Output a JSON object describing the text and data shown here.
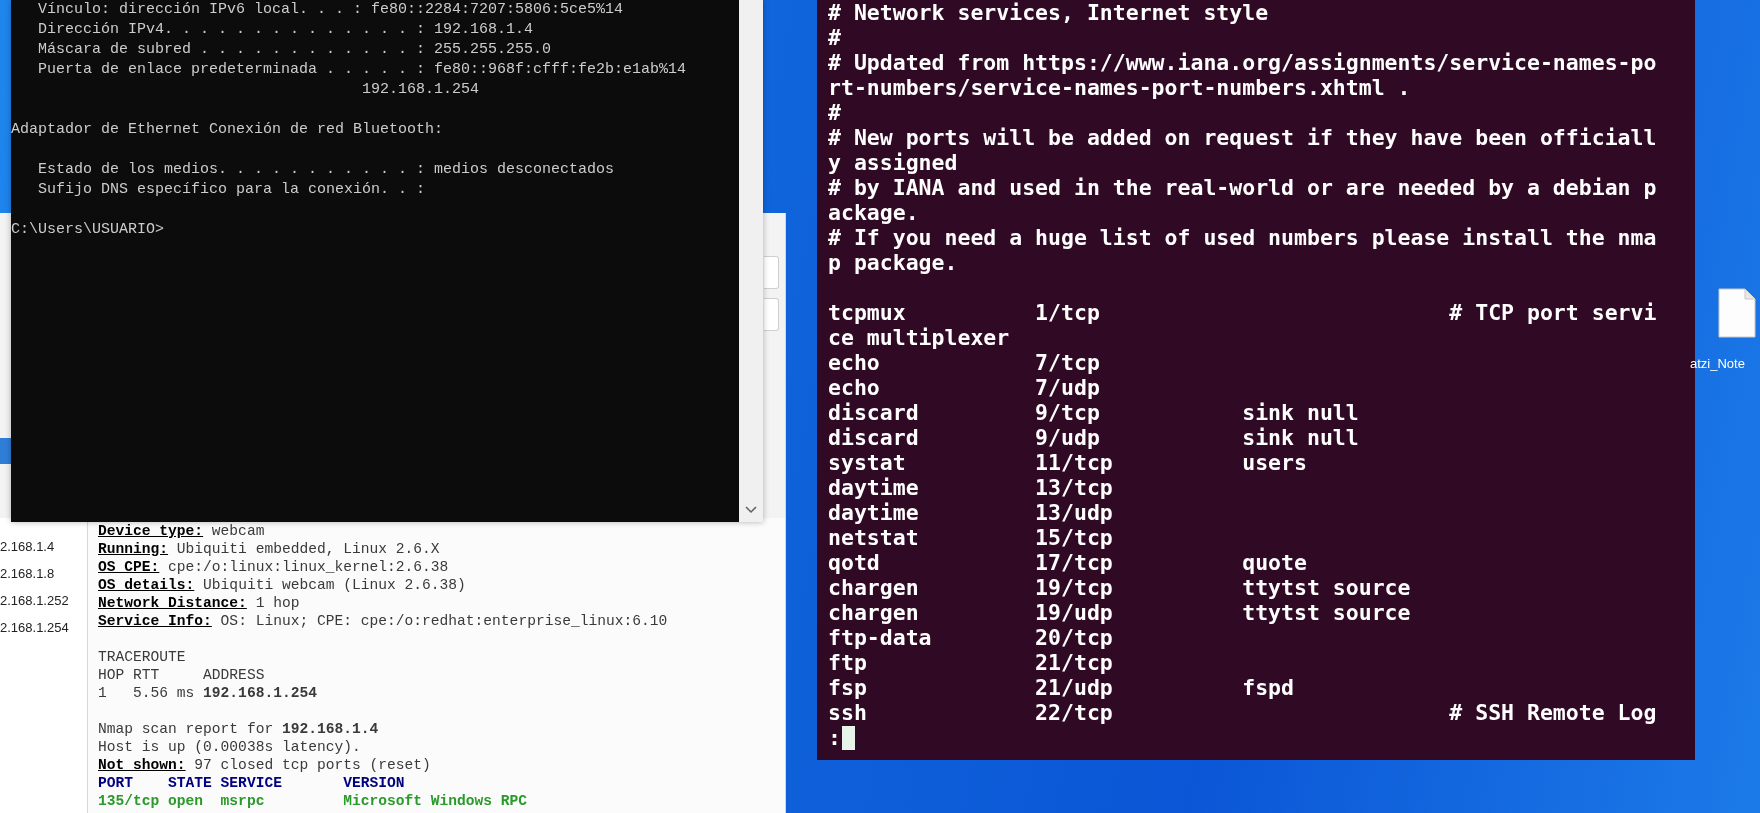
{
  "cmd_window": {
    "blocks": [
      {
        "lines": [
          "   Vínculo: dirección IPv6 local. . . : fe80::2284:7207:5806:5ce5%14",
          "   Dirección IPv4. . . . . . . . . . . . . . : 192.168.1.4",
          "   Máscara de subred . . . . . . . . . . . . : 255.255.255.0",
          "   Puerta de enlace predeterminada . . . . . : fe80::968f:cfff:fe2b:e1ab%14",
          "                                       192.168.1.254"
        ]
      },
      {
        "lines": [
          "Adaptador de Ethernet Conexión de red Bluetooth:"
        ]
      },
      {
        "lines": [
          "   Estado de los medios. . . . . . . . . . . : medios desconectados",
          "   Sufijo DNS específico para la conexión. . :"
        ]
      },
      {
        "lines": [
          "C:\\Users\\USUARIO>"
        ]
      }
    ]
  },
  "zenmap": {
    "hosts": [
      {
        "label": "2.168.1.4"
      },
      {
        "label": "2.168.1.8"
      },
      {
        "label": "2.168.1.252"
      },
      {
        "label": "2.168.1.254"
      }
    ],
    "output_blocks": [
      {
        "lines": [
          {
            "kind": "field",
            "label": "Device type:",
            "value": "webcam"
          },
          {
            "kind": "field",
            "label": "Running:",
            "value": "Ubiquiti embedded, Linux 2.6.X"
          },
          {
            "kind": "field",
            "label": "OS CPE:",
            "value": "cpe:/o:linux:linux_kernel:2.6.38"
          },
          {
            "kind": "field",
            "label": "OS details:",
            "value": "Ubiquiti webcam (Linux 2.6.38)"
          },
          {
            "kind": "field",
            "label": "Network Distance:",
            "value": "1 hop"
          },
          {
            "kind": "field",
            "label": "Service Info:",
            "value": "OS: Linux; CPE: cpe:/o:redhat:enterprise_linux:6.10"
          }
        ]
      },
      {
        "lines": [
          {
            "kind": "text",
            "text": "TRACEROUTE"
          },
          {
            "kind": "text",
            "text": "HOP RTT     ADDRESS"
          },
          {
            "kind": "text",
            "text": "1   5.56 ms **192.168.1.254**"
          }
        ]
      },
      {
        "lines": [
          {
            "kind": "text",
            "text": "Nmap scan report for **192.168.1.4**"
          },
          {
            "kind": "text",
            "text": "Host is up (0.00038s latency)."
          },
          {
            "kind": "field",
            "label": "Not shown:",
            "value": "97 closed tcp ports (reset)"
          },
          {
            "kind": "header",
            "text": "PORT    STATE SERVICE       VERSION"
          },
          {
            "kind": "port",
            "text": "135/tcp open  msrpc         Microsoft Windows RPC"
          }
        ]
      }
    ]
  },
  "terminal": {
    "header_lines": [
      "# Network services, Internet style",
      "#",
      "# Updated from https://www.iana.org/assignments/service-names-po",
      "rt-numbers/service-names-port-numbers.xhtml .",
      "#",
      "# New ports will be added on request if they have been officiall",
      "y assigned",
      "# by IANA and used in the real-world or are needed by a debian p",
      "ackage.",
      "# If you need a huge list of used numbers please install the nma",
      "p package."
    ],
    "service_lines": [
      "tcpmux          1/tcp                           # TCP port servi",
      "ce multiplexer",
      "echo            7/tcp",
      "echo            7/udp",
      "discard         9/tcp           sink null",
      "discard         9/udp           sink null",
      "systat          11/tcp          users",
      "daytime         13/tcp",
      "daytime         13/udp",
      "netstat         15/tcp",
      "qotd            17/tcp          quote",
      "chargen         19/tcp          ttytst source",
      "chargen         19/udp          ttytst source",
      "ftp-data        20/tcp",
      "ftp             21/tcp",
      "fsp             21/udp          fspd",
      "ssh             22/tcp                          # SSH Remote Log"
    ],
    "prompt": ":"
  },
  "desktop": {
    "icons": [
      {
        "label": "atzi_Note"
      }
    ]
  }
}
